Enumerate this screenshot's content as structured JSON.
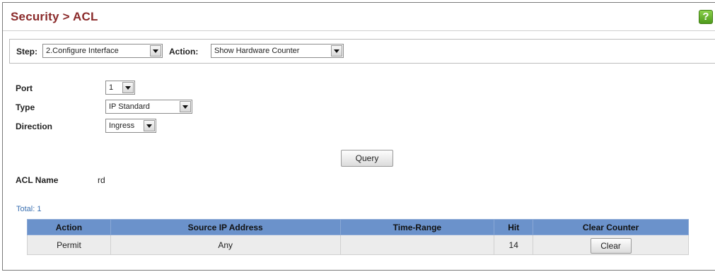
{
  "header": {
    "title": "Security > ACL",
    "help_icon": "help-icon"
  },
  "step_bar": {
    "step_label": "Step:",
    "step_value": "2.Configure Interface",
    "action_label": "Action:",
    "action_value": "Show Hardware Counter"
  },
  "form": {
    "port_label": "Port",
    "port_value": "1",
    "type_label": "Type",
    "type_value": "IP Standard",
    "direction_label": "Direction",
    "direction_value": "Ingress",
    "query_button": "Query",
    "acl_name_label": "ACL Name",
    "acl_name_value": "rd"
  },
  "table": {
    "total": "Total: 1",
    "columns": [
      "Action",
      "Source IP Address",
      "Time-Range",
      "Hit",
      "Clear Counter"
    ],
    "rows": [
      {
        "action": "Permit",
        "source_ip": "Any",
        "time_range": "",
        "hit": "14",
        "clear_button": "Clear"
      }
    ]
  },
  "colors": {
    "title": "#8a2a2a",
    "table_header": "#6b92cb",
    "total_text": "#3a6fb0"
  }
}
